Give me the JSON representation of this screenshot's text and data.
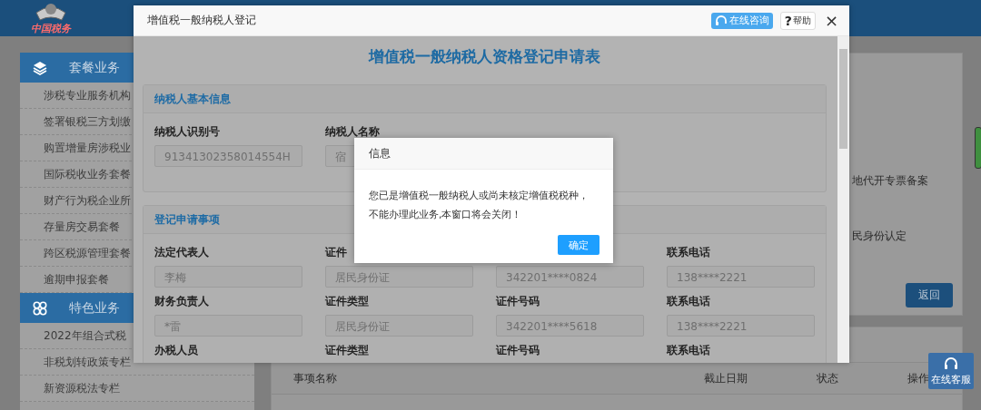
{
  "header": {
    "logo_text": "中国税务"
  },
  "sidebar": {
    "sections": [
      {
        "kind": "package",
        "title": "套餐业务",
        "items": [
          "涉税专业服务机构",
          "签署银税三方划缴",
          "购置增量房涉税业",
          "国际税收业务套餐",
          "财产行为税企业所",
          "存量房交易套餐",
          "跨区税源管理套餐",
          "逾期申报套餐"
        ]
      },
      {
        "kind": "feature",
        "title": "特色业务",
        "items": [
          "2022年组合式税",
          "非税划转政策专栏",
          "新资源税法专栏"
        ]
      }
    ]
  },
  "main": {
    "items": [
      "地代开专票备案",
      "民身份认定"
    ],
    "back_button": "返回",
    "table": {
      "columns": [
        "事项名称",
        "截止日期",
        "状态",
        "操作"
      ]
    }
  },
  "float_service": {
    "label": "在线客服"
  },
  "modal": {
    "title": "增值税一般纳税人登记",
    "consult_button": "在线咨询",
    "help_icon": "?",
    "help_button": "帮助",
    "close": "×",
    "heading": "增值税一般纳税人资格登记申请表",
    "sections": [
      {
        "title": "纳税人基本信息",
        "rows": [
          [
            {
              "label": "纳税人识别号",
              "value": "91341302358014554H"
            },
            {
              "label": "纳税人名称",
              "value": "宿"
            }
          ]
        ]
      },
      {
        "title": "登记申请事项",
        "rows": [
          [
            {
              "label": "法定代表人",
              "value": "李梅"
            },
            {
              "label": "证件",
              "value": "居民身份证"
            },
            {
              "value": "342201****0824"
            },
            {
              "label": "联系电话",
              "value": "138****2221"
            }
          ],
          [
            {
              "label": "财务负责人",
              "value": "*雷"
            },
            {
              "label": "证件类型",
              "value": "居民身份证"
            },
            {
              "label": "证件号码",
              "value": "342201****5618"
            },
            {
              "label": "联系电话",
              "value": "138****2221"
            }
          ],
          [
            {
              "label": "办税人员"
            },
            {
              "label": "证件类型"
            },
            {
              "label": "证件号码"
            },
            {
              "label": "联系电话"
            }
          ]
        ]
      }
    ]
  },
  "dialog": {
    "title": "信息",
    "message_lines": [
      "您已是增值税一般纳税人或尚未核定增值税税种，",
      "不能办理此业务,本窗口将会关闭！"
    ],
    "ok_button": "确定"
  }
}
